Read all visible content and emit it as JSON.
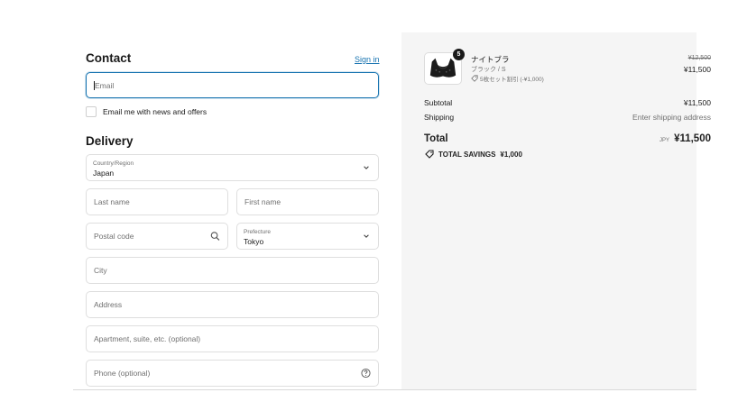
{
  "contact": {
    "heading": "Contact",
    "sign_in": "Sign in",
    "email_placeholder": "Email",
    "newsletter_label": "Email me with news and offers"
  },
  "delivery": {
    "heading": "Delivery",
    "country_label": "Country/Region",
    "country_value": "Japan",
    "last_name_placeholder": "Last name",
    "first_name_placeholder": "First name",
    "postal_placeholder": "Postal code",
    "prefecture_label": "Prefecture",
    "prefecture_value": "Tokyo",
    "city_placeholder": "City",
    "address_placeholder": "Address",
    "apartment_placeholder": "Apartment, suite, etc. (optional)",
    "phone_placeholder": "Phone (optional)"
  },
  "order": {
    "item": {
      "name": "ナイトブラ",
      "variant": "ブラック / S",
      "discount": "5枚セット割引 (-¥1,000)",
      "quantity": "5",
      "original_price": "¥12,500",
      "price": "¥11,500",
      "image_icon": "bra-product-image"
    },
    "subtotal_label": "Subtotal",
    "subtotal_value": "¥11,500",
    "shipping_label": "Shipping",
    "shipping_value": "Enter shipping address",
    "total_label": "Total",
    "total_currency": "JPY",
    "total_value": "¥11,500",
    "savings_label": "TOTAL SAVINGS",
    "savings_value": "¥1,000"
  },
  "colors": {
    "accent": "#1773b0",
    "panel": "#f5f5f5",
    "border": "#dedede",
    "text": "#1a1a1a",
    "muted": "#707070"
  }
}
